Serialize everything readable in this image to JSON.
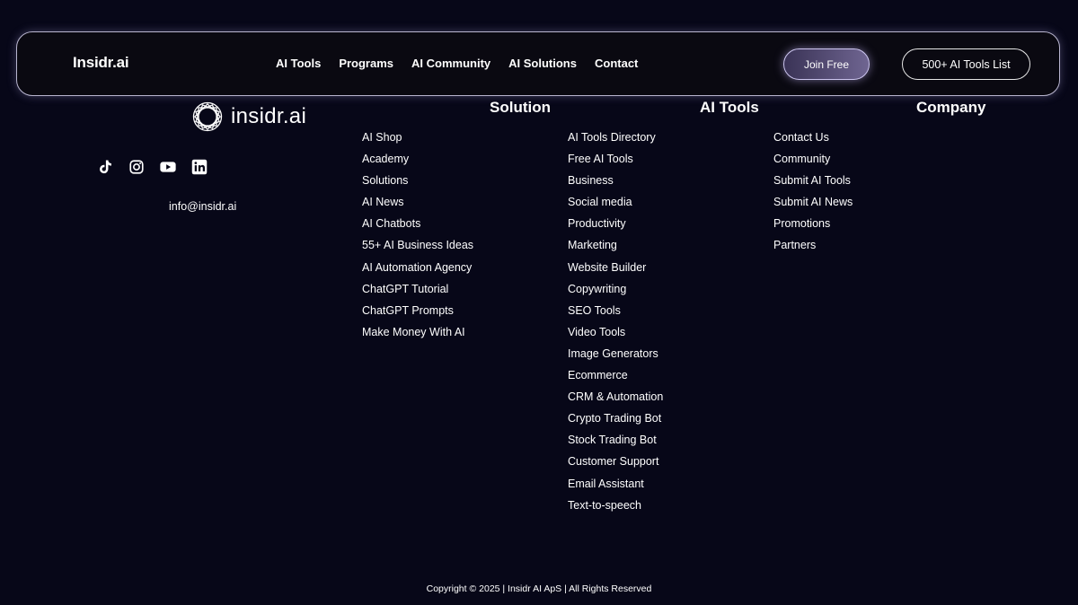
{
  "header": {
    "brand": "Insidr.ai",
    "menu": [
      "AI Tools",
      "Programs",
      "AI Community",
      "AI Solutions",
      "Contact"
    ],
    "join_label": "Join Free",
    "tools_list_label": "500+ AI Tools List"
  },
  "footer": {
    "logo_text": "insidr.ai",
    "socials": [
      "tiktok-icon",
      "instagram-icon",
      "youtube-icon",
      "linkedin-icon"
    ],
    "email": "info@insidr.ai",
    "columns": {
      "solution": {
        "title": "Solution",
        "links": [
          "AI Shop",
          "Academy",
          "Solutions",
          "AI News",
          "AI Chatbots",
          "55+ AI Business Ideas",
          "AI Automation Agency",
          "ChatGPT Tutorial",
          "ChatGPT Prompts",
          "Make Money With AI"
        ]
      },
      "ai_tools": {
        "title": "AI Tools",
        "links": [
          "AI Tools Directory",
          "Free AI Tools",
          "Business",
          "Social media",
          "Productivity",
          "Marketing",
          "Website Builder",
          "Copywriting",
          "SEO Tools",
          "Video Tools",
          "Image Generators",
          "Ecommerce",
          "CRM & Automation",
          "Crypto Trading Bot",
          "Stock Trading Bot",
          "Customer Support",
          "Email Assistant",
          "Text-to-speech"
        ]
      },
      "company": {
        "title": "Company",
        "links": [
          "Contact Us",
          "Community",
          "Submit AI Tools",
          "Submit AI News",
          "Promotions",
          "Partners"
        ]
      }
    },
    "copyright": "Copyright © 2025 | Insidr AI ApS | All Rights Reserved"
  },
  "colors": {
    "background": "#070718",
    "accent": "#6f6591",
    "border": "#b9b6cf"
  }
}
